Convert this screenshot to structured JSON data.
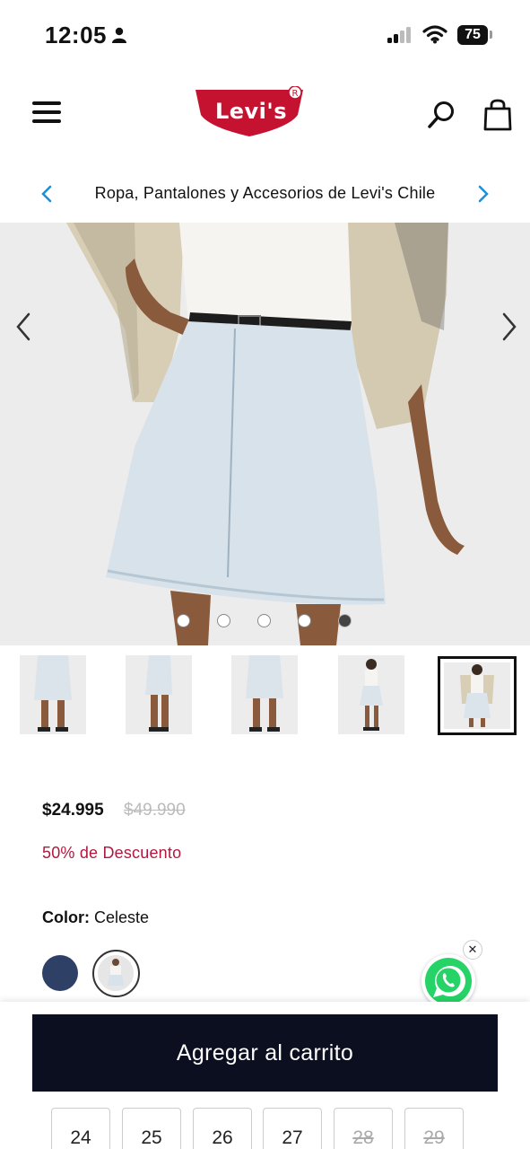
{
  "status_bar": {
    "time": "12:05",
    "battery": "75"
  },
  "header": {
    "logo": "Levi's",
    "menu_icon": "menu-icon",
    "search_icon": "search-icon",
    "bag_icon": "shopping-bag-icon"
  },
  "promo": {
    "text": "Ropa, Pantalones y Accesorios de Levi's Chile"
  },
  "gallery": {
    "images": [
      "skirt-front",
      "skirt-side",
      "skirt-back",
      "full-body",
      "model-cardigan"
    ],
    "active_index": 4,
    "dot_count": 5
  },
  "product": {
    "price": "$24.995",
    "original_price": "$49.990",
    "discount": "50% de Descuento",
    "color_label": "Color:",
    "color_value": "Celeste",
    "swatches": [
      {
        "name": "navy",
        "color": "#2e4066"
      },
      {
        "name": "celeste",
        "color": "#dfe6ec",
        "selected": true
      }
    ]
  },
  "cart": {
    "add_label": "Agregar al carrito"
  },
  "sizes": [
    {
      "label": "24",
      "available": true
    },
    {
      "label": "25",
      "available": true
    },
    {
      "label": "26",
      "available": true
    },
    {
      "label": "27",
      "available": true
    },
    {
      "label": "28",
      "available": false
    },
    {
      "label": "29",
      "available": false
    }
  ],
  "colors": {
    "brand_red": "#c41230",
    "discount": "#b0183f",
    "cta": "#0c0f1f"
  }
}
